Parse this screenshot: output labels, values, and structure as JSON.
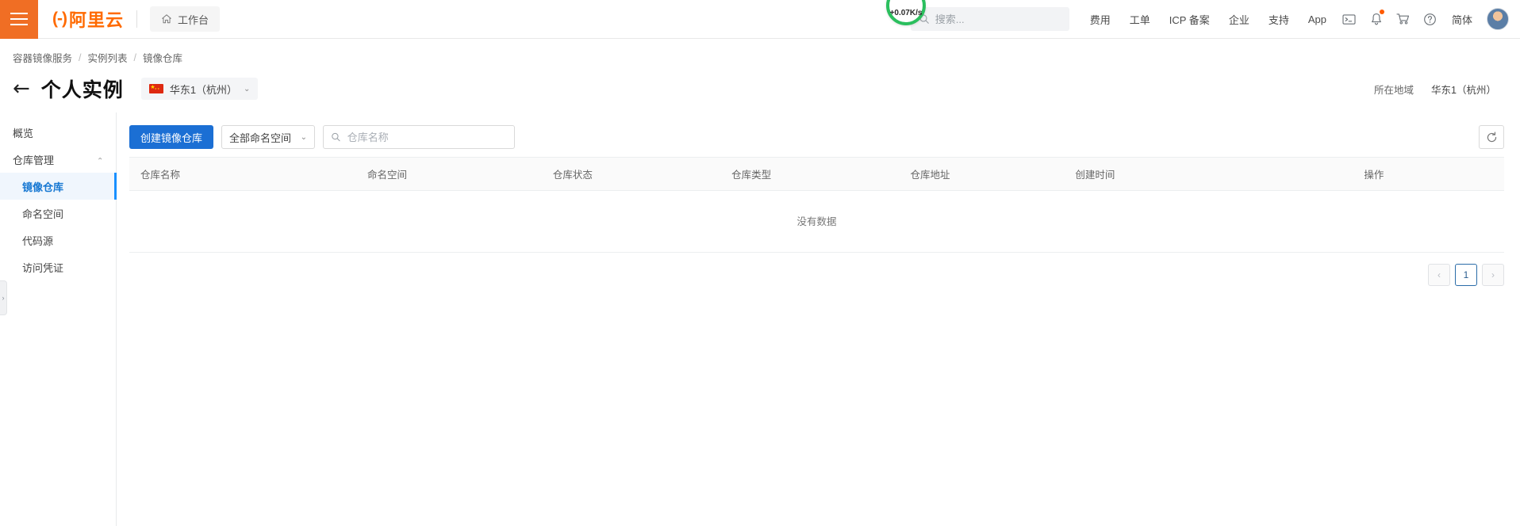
{
  "header": {
    "menu_icon": "hamburger-icon",
    "brand_mark": "(-)",
    "brand_text": "阿里云",
    "workbench_label": "工作台",
    "home_icon": "home-icon",
    "search": {
      "placeholder": "搜索...",
      "value": "",
      "icon": "search-icon"
    },
    "nav_links": [
      "费用",
      "工单",
      "ICP 备案",
      "企业",
      "支持",
      "App"
    ],
    "icons": [
      {
        "name": "terminal-icon",
        "badge": false
      },
      {
        "name": "bell-icon",
        "badge": true
      },
      {
        "name": "cart-icon",
        "badge": false
      },
      {
        "name": "help-icon",
        "badge": false
      }
    ],
    "language_label": "简体",
    "avatar_name": "user-avatar",
    "network_speed": "+0.07K/s",
    "network_speed_color": "#2bbf5e"
  },
  "breadcrumb": {
    "items": [
      "容器镜像服务",
      "实例列表",
      "镜像仓库"
    ],
    "separator": "/"
  },
  "page": {
    "back_icon": "←",
    "title": "个人实例",
    "region_selector": {
      "label": "华东1（杭州）",
      "flag": "cn-flag-icon",
      "chevron": "⌄"
    },
    "region_info_label": "所在地域",
    "region_info_value": "华东1（杭州）"
  },
  "sidebar": {
    "items": [
      {
        "label": "概览",
        "level": "top",
        "active": false,
        "expandable": false
      },
      {
        "label": "仓库管理",
        "level": "top",
        "active": false,
        "expandable": true,
        "caret": "⌄"
      },
      {
        "label": "镜像仓库",
        "level": "sub",
        "active": true,
        "expandable": false
      },
      {
        "label": "命名空间",
        "level": "sub",
        "active": false,
        "expandable": false
      },
      {
        "label": "代码源",
        "level": "sub",
        "active": false,
        "expandable": false
      },
      {
        "label": "访问凭证",
        "level": "sub",
        "active": false,
        "expandable": false
      }
    ],
    "collapse_handle_icon": "›"
  },
  "toolbar": {
    "create_button": "创建镜像仓库",
    "namespace_select": {
      "value": "全部命名空间",
      "chevron": "⌄"
    },
    "search": {
      "placeholder": "仓库名称",
      "value": "",
      "icon": "search-icon"
    },
    "refresh_icon": "refresh-icon"
  },
  "table": {
    "columns": [
      "仓库名称",
      "命名空间",
      "仓库状态",
      "仓库类型",
      "仓库地址",
      "创建时间",
      "操作"
    ],
    "rows": [],
    "empty_text": "没有数据"
  },
  "pagination": {
    "prev": "‹",
    "next": "›",
    "pages": [
      "1"
    ],
    "current": "1"
  },
  "colors": {
    "brand_orange": "#ff6a00",
    "primary_blue": "#1b6fd4",
    "active_blue": "#1677d2",
    "accent_green": "#2bbf5e"
  }
}
